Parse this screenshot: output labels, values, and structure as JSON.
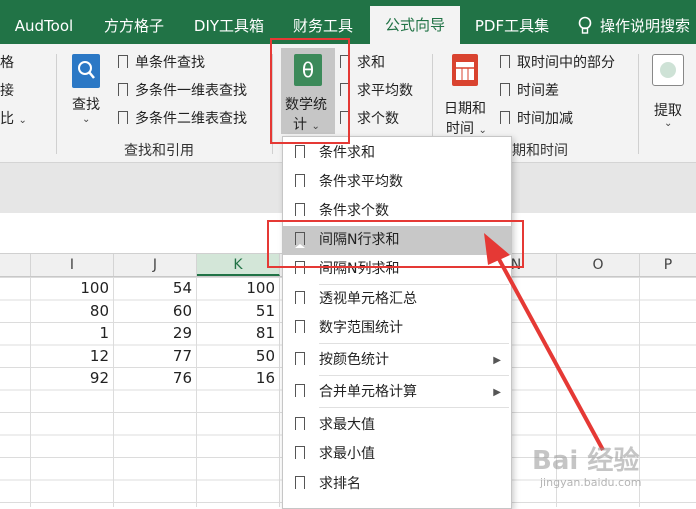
{
  "tabs": [
    "AudTool",
    "方方格子",
    "DIY工具箱",
    "财务工具",
    "公式向导",
    "PDF工具集",
    "操作说明搜索"
  ],
  "ribbon": {
    "left_stub": [
      "格",
      "接",
      "比"
    ],
    "lookup_button": "查找",
    "lookup_items": [
      "单条件查找",
      "多条件一维表查找",
      "多条件二维表查找"
    ],
    "lookup_group_label": "查找和引用",
    "math_button_line1": "数学统",
    "math_button_line2": "计",
    "math_icon_glyph": "θ",
    "sum_items": [
      "求和",
      "求平均数",
      "求个数"
    ],
    "date_button_line1": "日期和",
    "date_button_line2": "时间",
    "date_items": [
      "取时间中的部分",
      "时间差",
      "时间加减"
    ],
    "date_group_label": "期和时间",
    "extract_button": "提取"
  },
  "columns": [
    "I",
    "J",
    "K",
    "N",
    "O",
    "P"
  ],
  "rows": [
    [
      "100",
      "54",
      "100"
    ],
    [
      "80",
      "60",
      "51"
    ],
    [
      "1",
      "29",
      "81"
    ],
    [
      "12",
      "77",
      "50"
    ],
    [
      "92",
      "76",
      "16"
    ]
  ],
  "menu": {
    "items": [
      {
        "label": "条件求和"
      },
      {
        "label": "条件求平均数"
      },
      {
        "label": "条件求个数"
      },
      {
        "label": "间隔N行求和",
        "highlighted": true
      },
      {
        "label": "间隔N列求和"
      },
      {
        "label": "透视单元格汇总"
      },
      {
        "label": "数字范围统计"
      },
      {
        "label": "按颜色统计",
        "submenu": true
      },
      {
        "label": "合并单元格计算",
        "submenu": true
      },
      {
        "label": "求最大值"
      },
      {
        "label": "求最小值"
      },
      {
        "label": "求排名"
      }
    ]
  },
  "watermark": {
    "main": "Bai 经验",
    "sub": "jingyan.baidu.com"
  },
  "colors": {
    "excel_green": "#217346",
    "highlight": "#c8c8c8",
    "annotation_red": "#e53935"
  },
  "icons": [
    "lightbulb-icon",
    "search-doc-icon",
    "theta-icon",
    "calendar-icon",
    "extract-icon",
    "bookmark-icon",
    "chevron-right-icon"
  ]
}
